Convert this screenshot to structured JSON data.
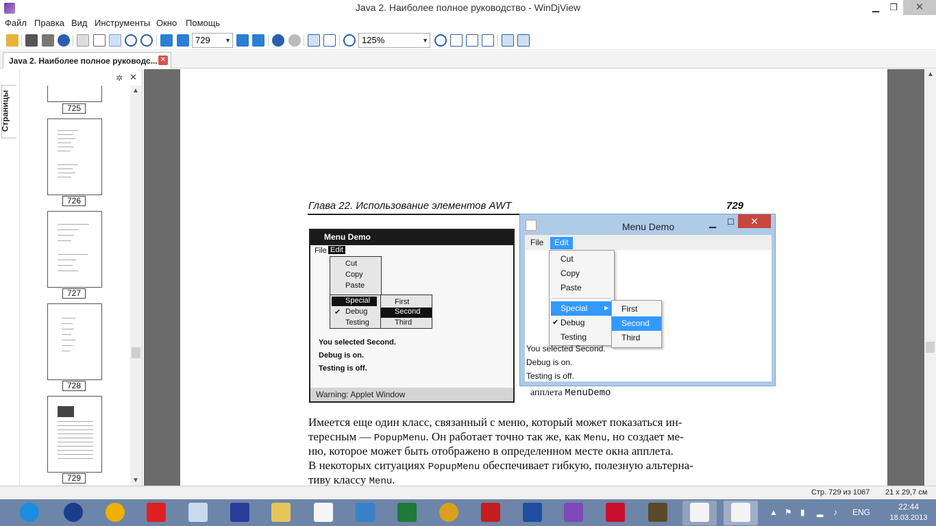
{
  "window": {
    "title": "Java 2. Наиболее полное руководство - WinDjView",
    "min_glyph": "▁",
    "max_glyph": "❐",
    "close_glyph": "✕"
  },
  "menu": [
    "Файл",
    "Правка",
    "Вид",
    "Инструменты",
    "Окно",
    "Помощь"
  ],
  "toolbar": {
    "page_value": "729",
    "zoom_value": "125%"
  },
  "tab": {
    "label": "Java 2. Наиболее полное руководс...",
    "close_glyph": "✕"
  },
  "sidebar": {
    "vertical_tab": "Страницы",
    "thumbnails": [
      "725",
      "726",
      "727",
      "728",
      "729"
    ]
  },
  "document": {
    "chapter_header": "Глава 22. Использование элементов AWT",
    "page_number": "729",
    "scan": {
      "title": "Menu Demo",
      "menus": [
        "File",
        "Edit"
      ],
      "items": [
        "Cut",
        "Copy",
        "Paste",
        "Special",
        "Debug",
        "Testing"
      ],
      "submenu": [
        "First",
        "Second",
        "Third"
      ],
      "status": [
        "You selected Second.",
        "Debug is on.",
        "Testing is off."
      ],
      "warning": "Warning: Applet Window"
    },
    "demo_window": {
      "title": "Menu Demo",
      "menus": [
        "File",
        "Edit"
      ],
      "items": [
        "Cut",
        "Copy",
        "Paste",
        "Special",
        "Debug",
        "Testing"
      ],
      "submenu": [
        "First",
        "Second",
        "Third"
      ],
      "status": [
        "You selected Second.",
        "Debug is on.",
        "Testing is off."
      ]
    },
    "caption_prefix": "апплета ",
    "caption_code": "MenuDemo",
    "paragraph": [
      {
        "parts": [
          "Имеется еще один класс, связанный с меню, который может показаться ин-"
        ]
      },
      {
        "parts": [
          "тересным — ",
          "PopupMenu",
          ". Он работает точно так же, как ",
          "Menu",
          ", но создает ме-"
        ]
      },
      {
        "parts": [
          "ню, которое может быть отображено в определенном месте окна апплета."
        ]
      },
      {
        "parts": [
          "В некоторых ситуациях ",
          "PopupMenu",
          " обеспечивает гибкую, полезную альтерна-"
        ]
      },
      {
        "parts": [
          "тиву классу ",
          "Menu",
          "."
        ]
      }
    ]
  },
  "status": {
    "pages": "Стр. 729 из 1067",
    "size": "21 x 29,7 см"
  },
  "taskbar": {
    "lang": "ENG",
    "time": "22:44",
    "date": "18.03.2013"
  }
}
